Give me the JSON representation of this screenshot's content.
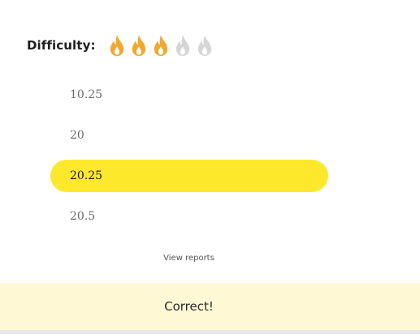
{
  "difficulty": {
    "label": "Difficulty:",
    "level": 3,
    "max_level": 5,
    "active_color": "#f0a830",
    "inactive_color": "#d6d6d6"
  },
  "options": [
    {
      "text": "10.25",
      "selected": false
    },
    {
      "text": "20",
      "selected": false
    },
    {
      "text": "20.25",
      "selected": true
    },
    {
      "text": "20.5",
      "selected": false
    }
  ],
  "colors": {
    "selected_option": "#fde82c",
    "feedback_bar": "#fff8d4"
  },
  "view_reports": "View reports",
  "feedback": {
    "text": "Correct!"
  }
}
